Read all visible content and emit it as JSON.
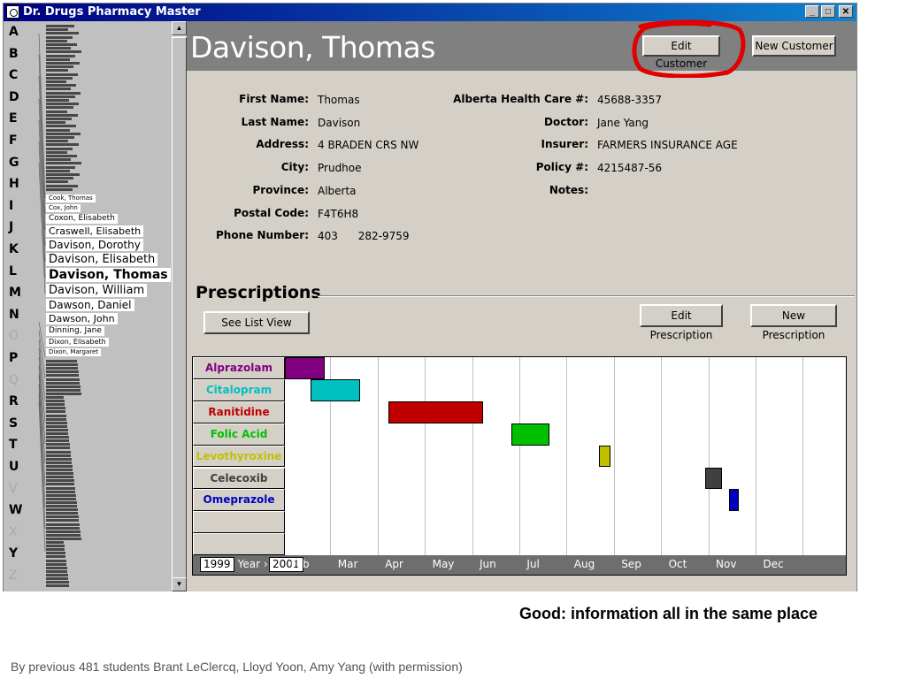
{
  "window": {
    "title": "Dr. Drugs Pharmacy Master",
    "controls": [
      "_",
      "□",
      "✕"
    ]
  },
  "alphabet": [
    {
      "letter": "A",
      "enabled": true
    },
    {
      "letter": "B",
      "enabled": true
    },
    {
      "letter": "C",
      "enabled": true
    },
    {
      "letter": "D",
      "enabled": true
    },
    {
      "letter": "E",
      "enabled": true
    },
    {
      "letter": "F",
      "enabled": true
    },
    {
      "letter": "G",
      "enabled": true
    },
    {
      "letter": "H",
      "enabled": true
    },
    {
      "letter": "I",
      "enabled": true
    },
    {
      "letter": "J",
      "enabled": true
    },
    {
      "letter": "K",
      "enabled": true
    },
    {
      "letter": "L",
      "enabled": true
    },
    {
      "letter": "M",
      "enabled": true
    },
    {
      "letter": "N",
      "enabled": true
    },
    {
      "letter": "O",
      "enabled": false
    },
    {
      "letter": "P",
      "enabled": true
    },
    {
      "letter": "Q",
      "enabled": false
    },
    {
      "letter": "R",
      "enabled": true
    },
    {
      "letter": "S",
      "enabled": true
    },
    {
      "letter": "T",
      "enabled": true
    },
    {
      "letter": "U",
      "enabled": true
    },
    {
      "letter": "V",
      "enabled": false
    },
    {
      "letter": "W",
      "enabled": true
    },
    {
      "letter": "X",
      "enabled": false
    },
    {
      "letter": "Y",
      "enabled": true
    },
    {
      "letter": "Z",
      "enabled": false
    }
  ],
  "customer_list": {
    "visible_names": [
      {
        "name": "Cook, Thomas",
        "size": 7,
        "selected": false
      },
      {
        "name": "Cox, John",
        "size": 7,
        "selected": false
      },
      {
        "name": "Coxon, Elisabeth",
        "size": 9,
        "selected": false
      },
      {
        "name": "Craswell, Elisabeth",
        "size": 11,
        "selected": false
      },
      {
        "name": "Davison, Dorothy",
        "size": 12,
        "selected": false
      },
      {
        "name": "Davison, Elisabeth",
        "size": 13,
        "selected": false
      },
      {
        "name": "Davison, Thomas",
        "size": 14,
        "selected": true
      },
      {
        "name": "Davison, William",
        "size": 13,
        "selected": false
      },
      {
        "name": "Dawson, Daniel",
        "size": 12,
        "selected": false
      },
      {
        "name": "Dawson, John",
        "size": 11,
        "selected": false
      },
      {
        "name": "Dinning, Jane",
        "size": 9,
        "selected": false
      },
      {
        "name": "Dixon, Elisabeth",
        "size": 8,
        "selected": false
      },
      {
        "name": "Dixon, Margaret",
        "size": 7,
        "selected": false
      }
    ]
  },
  "header": {
    "customer_name": "Davison, Thomas",
    "edit_customer_label": "Edit Customer",
    "new_customer_label": "New Customer"
  },
  "details": {
    "left": [
      {
        "label": "First Name:",
        "value": "Thomas"
      },
      {
        "label": "Last Name:",
        "value": "Davison"
      },
      {
        "label": "Address:",
        "value": "4 BRADEN CRS NW"
      },
      {
        "label": "City:",
        "value": "Prudhoe"
      },
      {
        "label": "Province:",
        "value": "Alberta"
      },
      {
        "label": "Postal Code:",
        "value": "F4T6H8"
      },
      {
        "label": "Phone Number:",
        "value": "403      282-9759"
      }
    ],
    "right": [
      {
        "label": "Alberta Health Care #:",
        "value": "45688-3357"
      },
      {
        "label": "Doctor:",
        "value": "Jane Yang"
      },
      {
        "label": "Insurer:",
        "value": "FARMERS INSURANCE AGE"
      },
      {
        "label": "Policy #:",
        "value": "4215487-56"
      },
      {
        "label": "Notes:",
        "value": ""
      }
    ]
  },
  "prescriptions": {
    "title": "Prescriptions",
    "see_list_view_label": "See List View",
    "edit_prescription_label": "Edit Prescription",
    "new_prescription_label": "New Prescription",
    "timeline": {
      "year_start": "1999",
      "year_label": "Year",
      "year_end": "2001",
      "months": [
        "Feb",
        "Mar",
        "Apr",
        "May",
        "Jun",
        "Jul",
        "Aug",
        "Sep",
        "Oct",
        "Nov",
        "Dec"
      ],
      "drugs": [
        {
          "name": "Alprazolam",
          "color": "#800080",
          "start_month": 0.0,
          "end_month": 0.85
        },
        {
          "name": "Citalopram",
          "color": "#00c0c0",
          "start_month": 0.55,
          "end_month": 1.6
        },
        {
          "name": "Ranitidine",
          "color": "#c00000",
          "start_month": 2.2,
          "end_month": 4.2
        },
        {
          "name": "Folic Acid",
          "color": "#00c000",
          "start_month": 4.8,
          "end_month": 5.6
        },
        {
          "name": "Levothyroxine",
          "color": "#c0c000",
          "start_month": 6.65,
          "end_month": 6.9
        },
        {
          "name": "Celecoxib",
          "color": "#404040",
          "start_month": 8.9,
          "end_month": 9.25
        },
        {
          "name": "Omeprazole",
          "color": "#0000c0",
          "start_month": 9.4,
          "end_month": 9.6
        }
      ],
      "empty_rows": 2
    }
  },
  "annotation_color": "#e00000",
  "caption": "Good: information all in the same place",
  "credit": "By previous 481 students Brant LeClercq, Lloyd Yoon, Amy Yang (with permission)"
}
